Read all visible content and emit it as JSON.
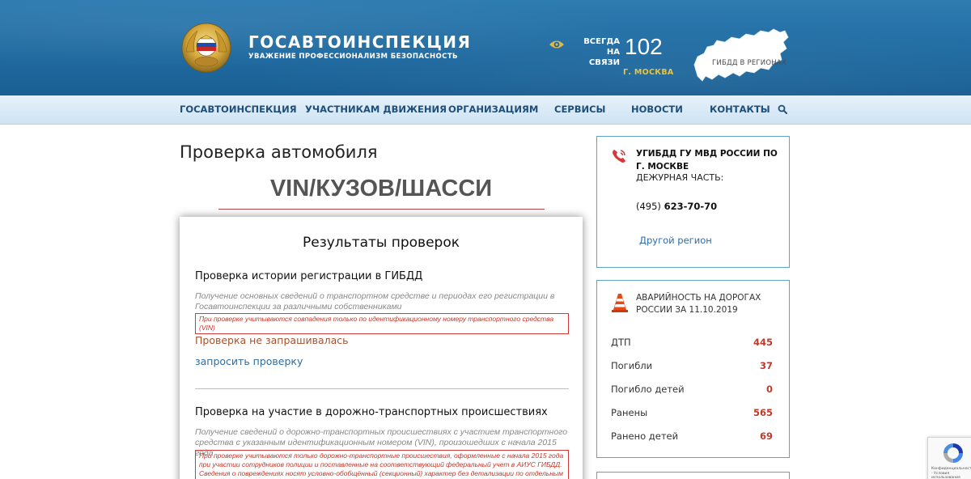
{
  "header": {
    "brand_title": "ГОСАВТОИНСПЕКЦИЯ",
    "brand_subtitle": "УВАЖЕНИЕ ПРОФЕССИОНАЛИЗМ БЕЗОПАСНОСТЬ",
    "always_line1": "ВСЕГДА",
    "always_line2": "НА СВЯЗИ",
    "phone": "102",
    "city": "Г. МОСКВА",
    "map_label": "ГИБДД В РЕГИОНАХ",
    "icons": {
      "emblem": "gibdd-emblem-icon",
      "eye": "eye-icon",
      "map": "russia-map-icon"
    }
  },
  "nav": {
    "items": [
      {
        "label": "ГОСАВТОИНСПЕКЦИЯ"
      },
      {
        "label": "УЧАСТНИКАМ ДВИЖЕНИЯ"
      },
      {
        "label": "ОРГАНИЗАЦИЯМ"
      },
      {
        "label": "СЕРВИСЫ"
      },
      {
        "label": "НОВОСТИ"
      },
      {
        "label": "КОНТАКТЫ"
      }
    ],
    "search_icon": "search-icon"
  },
  "main": {
    "page_title": "Проверка автомобиля",
    "vin_heading": "VIN/КУЗОВ/ШАССИ",
    "results": {
      "title": "Результаты проверок",
      "sections": [
        {
          "title": "Проверка истории регистрации в ГИБДД",
          "description": "Получение основных сведений о транспортном средстве и периодах его регистрации в Госавтоинспекции за различными собственниками",
          "note": "При проверке учитываются совпадения только по идентификационному номеру транспортного средства (VIN)",
          "status": "Проверка не запрашивалась",
          "action": "запросить проверку"
        },
        {
          "title": "Проверка на участие в дорожно-транспортных происшествиях",
          "description": "Получение сведений о дорожно-транспортных происшествиях с участием транспортного средства с указанным идентификационным номером (VIN), произошедших с начала 2015 года",
          "note": "При проверке учитываются только дорожно-транспортные происшествия, оформленные с начала 2015 года при участии сотрудников полиции и поставленные на соответствующий федеральный учет в АИУС ГИБДД. Сведения о повреждениях носят условно-обобщённый (секционный) характер без детализации по отдельным"
        }
      ]
    }
  },
  "sidebar": {
    "contact": {
      "org_name": "УГИБДД ГУ МВД РОССИИ ПО Г. МОСКВЕ",
      "duty_label": "ДЕЖУРНАЯ ЧАСТЬ:",
      "phone_code": "(495)",
      "phone_number": "623-70-70",
      "other_region": "Другой регион",
      "icon": "phone-icon"
    },
    "stats": {
      "title": "АВАРИЙНОСТЬ НА ДОРОГАХ РОССИИ ЗА 11.10.2019",
      "icon": "traffic-cone-icon",
      "rows": [
        {
          "label": "ДТП",
          "value": "445"
        },
        {
          "label": "Погибли",
          "value": "37"
        },
        {
          "label": "Погибло детей",
          "value": "0"
        },
        {
          "label": "Ранены",
          "value": "565"
        },
        {
          "label": "Ранено детей",
          "value": "69"
        }
      ]
    }
  },
  "recaptcha": {
    "text": "Конфиденциальность - Условия использования",
    "icon": "recaptcha-icon"
  },
  "colors": {
    "header_blue": "#2f7cb1",
    "nav_text": "#1f4e79",
    "accent_red": "#c0392b",
    "link_blue": "#2e6da4",
    "city_yellow": "#f1c232"
  }
}
